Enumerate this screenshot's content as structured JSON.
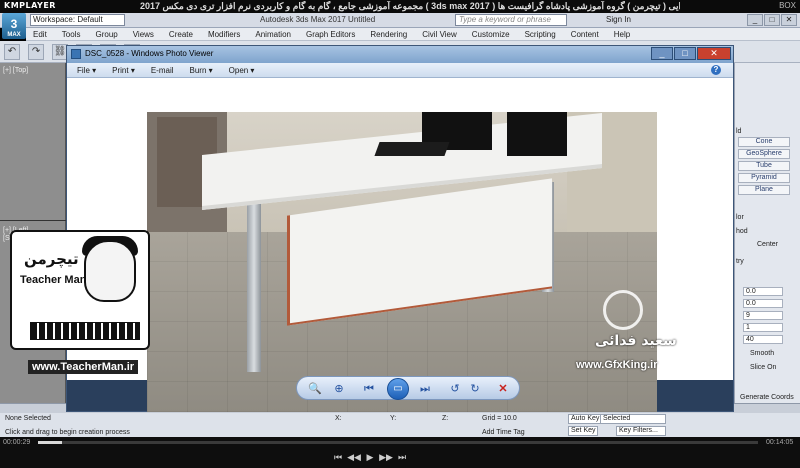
{
  "kmplayer": {
    "logo": "KMPLAYER",
    "title": "مجموعه آموزشی جامع ، گام به گام و کاربردی نرم افزار تری دی مکس 2017  ( 3ds max 2017 )  مدرس : سعید فدایی ( تیچرمن ) گروه آموزشی پادشاه گرافیست ها",
    "right_label": "BOX",
    "time_elapsed": "00:00:29",
    "time_total": "00:14:05",
    "progress": 0.034,
    "buttons": [
      "⏮",
      "◀◀",
      "▶",
      "▶▶",
      "⏭"
    ]
  },
  "app": {
    "logo_main": "3",
    "logo_sub": "MAX",
    "workspace": "Workspace: Default",
    "title": "Autodesk 3ds Max 2017     Untitled",
    "search_placeholder": "Type a keyword or phrase",
    "signin": "Sign In",
    "window_controls": [
      "_",
      "□",
      "✕"
    ],
    "menu": [
      "Edit",
      "Tools",
      "Group",
      "Views",
      "Create",
      "Modifiers",
      "Animation",
      "Graph Editors",
      "Rendering",
      "Civil View",
      "Customize",
      "Scripting",
      "Content",
      "Help"
    ],
    "toolbar_icons": [
      "↶",
      "↷",
      "⛓",
      "⛓",
      "▭",
      "▣"
    ],
    "viewport_labels": [
      "[+] [Top]",
      "[+] [Left]",
      "[Standa"
    ],
    "command_panel": {
      "buttons": [
        "Cone",
        "GeoSphere",
        "Tube",
        "Pyramid",
        "Plane"
      ],
      "labels": [
        "ld",
        "lor",
        "hod",
        "Center",
        "try"
      ],
      "spinners": [
        "0.0",
        "0.0",
        "9",
        "1",
        "40"
      ],
      "checks": [
        "Smooth",
        "Slice On"
      ],
      "bottom_label": "Generate Coords"
    },
    "status": {
      "selection": "None Selected",
      "prompt": "Click and drag to begin creation process",
      "x_label": "X:",
      "y_label": "Y:",
      "z_label": "Z:",
      "grid": "Grid = 10.0",
      "add_time_tag": "Add Time Tag",
      "auto_key": "Auto Key",
      "selected": "Selected",
      "set_key": "Set Key",
      "key_filters": "Key Filters..."
    }
  },
  "photo_viewer": {
    "title": "DSC_0528 - Windows Photo Viewer",
    "menu": [
      "File ▾",
      "Print ▾",
      "E-mail",
      "Burn ▾",
      "Open ▾"
    ],
    "help": "?",
    "window_controls": [
      "_",
      "□",
      "✕"
    ],
    "controls": [
      "🔍",
      "⊕",
      "⏮",
      "▭",
      "⏭",
      "↺",
      "↻",
      "✕"
    ]
  },
  "watermarks": {
    "teacherman_fa": "تیچرمن",
    "teacherman_name": "Teacher Man",
    "teacherman_url": "www.TeacherMan.ir",
    "gfx_fa": "سعید فدائی",
    "gfx_url": "www.GfxKing.ir"
  },
  "colors": {
    "km_bg": "#0b0b0b",
    "max_chrome": "#dde2ea",
    "pv_frame": "#2a3f5c",
    "accent_blue": "#2452a0",
    "delete_red": "#c8211e"
  }
}
